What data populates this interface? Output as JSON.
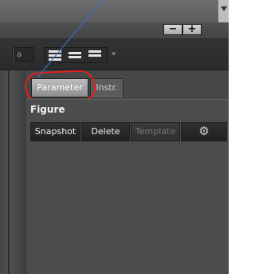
{
  "window": {
    "minus_label": "−",
    "plus_label": "+"
  },
  "toolbar": {
    "font_field": "a",
    "align_icons": [
      "align-left-icon",
      "align-center-icon",
      "align-right-icon"
    ],
    "more_glyph": "▪"
  },
  "tabs": [
    {
      "label": "Parameter",
      "active": true,
      "highlighted": true
    },
    {
      "label": "Instr.",
      "active": false
    }
  ],
  "figure": {
    "title": "Figure",
    "buttons": [
      {
        "label": "Snapshot",
        "enabled": true
      },
      {
        "label": "Delete",
        "enabled": true
      },
      {
        "label": "Template",
        "enabled": false
      },
      {
        "label": "",
        "icon": "gear-icon",
        "enabled": true
      }
    ]
  },
  "colors": {
    "highlight": "#e0201b",
    "pointer": "#3a6fc4"
  }
}
